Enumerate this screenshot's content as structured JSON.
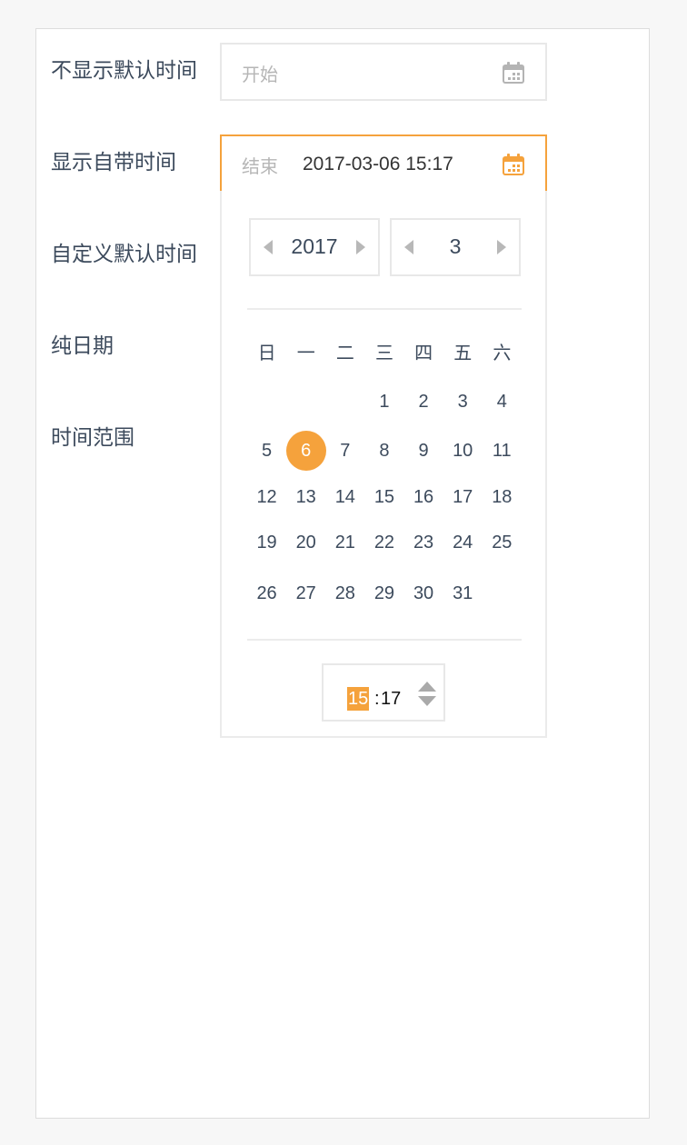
{
  "form": {
    "labels": [
      "不显示默认时间",
      "显示自带时间",
      "自定义默认时间",
      "纯日期",
      "时间范围"
    ],
    "start_placeholder": "开始",
    "end_placeholder": "结束",
    "end_value": "2017-03-06 15:17"
  },
  "icons": {
    "calendar": "calendar-icon",
    "prev": "caret-left-icon",
    "next": "caret-right-icon",
    "spin_up": "caret-up-icon",
    "spin_down": "caret-down-icon"
  },
  "colors": {
    "accent": "#f5a23c",
    "text": "#3c4a5c",
    "placeholder": "#b6b6b6",
    "border": "#e8e8e8",
    "icon_gray": "#aaaaaa"
  },
  "picker": {
    "year": "2017",
    "month": "3",
    "weekdays": [
      "日",
      "一",
      "二",
      "三",
      "四",
      "五",
      "六"
    ],
    "weeks": [
      [
        "",
        "",
        "",
        "1",
        "2",
        "3",
        "4"
      ],
      [
        "5",
        "6",
        "7",
        "8",
        "9",
        "10",
        "11"
      ],
      [
        "12",
        "13",
        "14",
        "15",
        "16",
        "17",
        "18"
      ],
      [
        "19",
        "20",
        "21",
        "22",
        "23",
        "24",
        "25"
      ],
      [
        "26",
        "27",
        "28",
        "29",
        "30",
        "31",
        ""
      ]
    ],
    "selected_day": "6",
    "time": {
      "hour": "15",
      "separator": ":",
      "minute": "17"
    }
  }
}
